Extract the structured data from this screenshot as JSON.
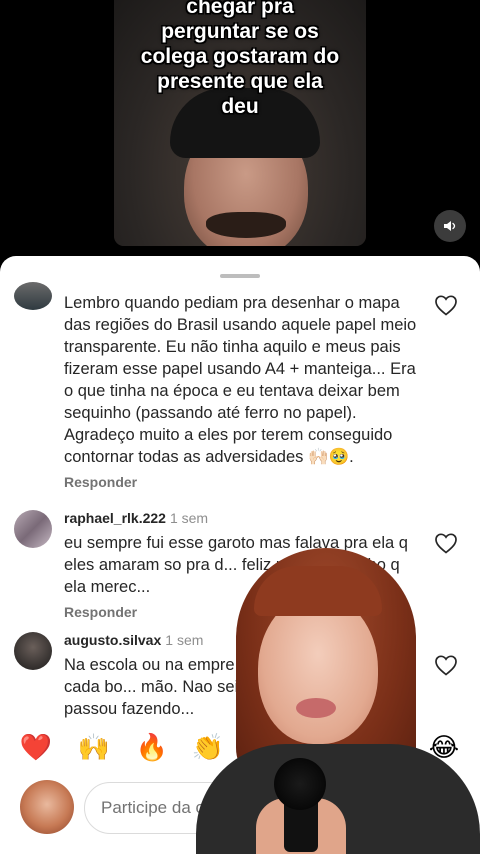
{
  "video": {
    "caption_lines": [
      "chegar pra",
      "perguntar se os",
      "colega gostaram do",
      "presente que ela",
      "deu"
    ],
    "volume_icon": "speaker-icon"
  },
  "comments": [
    {
      "username": "",
      "time": "",
      "text": "Lembro quando pediam pra desenhar o mapa das regiões do Brasil usando aquele papel meio transparente. Eu não tinha aquilo e meus pais fizeram esse papel usando A4 + manteiga... Era o que tinha na época e eu tentava deixar bem sequinho (passando até ferro no papel). Agradeço muito a eles por terem conseguido contornar todas as adversidades 🙌🏻🥹.",
      "reply_label": "Responder"
    },
    {
      "username": "raphael_rlk.222",
      "time": "1 sem",
      "text": "eu sempre fui esse garoto mas falava pra ela q eles amaram so pra d... feliz por n ter o filho q ela merec...",
      "reply_label": "Responder"
    },
    {
      "username": "augusto.silvax",
      "time": "1 sem",
      "text": "Na escola ou na empre... mia um pedaço de cada bo... mão. Nao sei quanto te... nessas passou fazendo...",
      "reply_label": ""
    }
  ],
  "emoji_bar": [
    "❤️",
    "🙌",
    "🔥",
    "👏",
    "😢",
    "😍",
    "😮",
    "😂"
  ],
  "input": {
    "placeholder": "Participe da c..."
  },
  "colors": {
    "heart_outline": "#262626",
    "text_primary": "#262626",
    "text_secondary": "#737373"
  }
}
